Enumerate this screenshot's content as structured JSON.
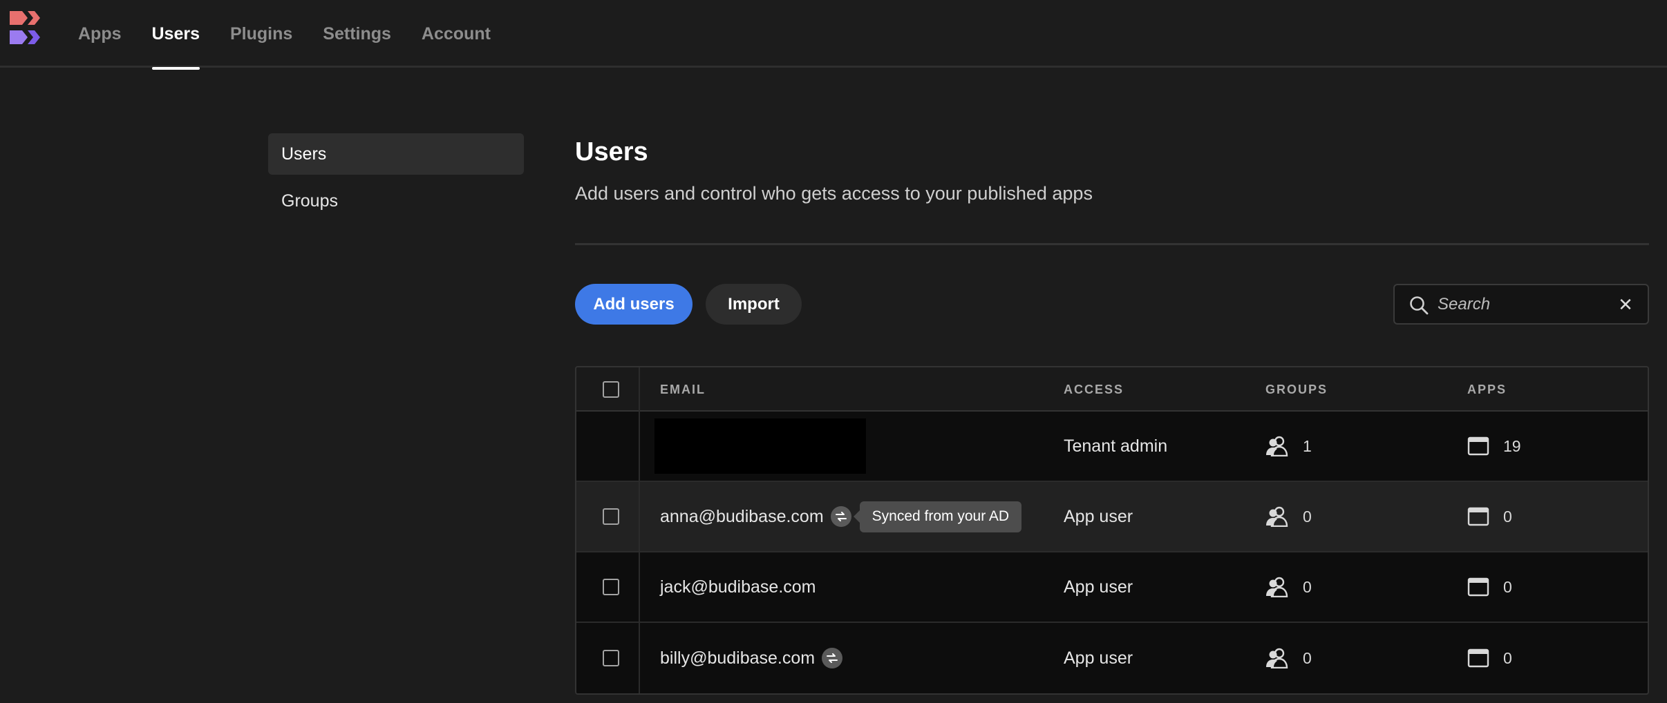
{
  "nav": {
    "items": [
      {
        "label": "Apps"
      },
      {
        "label": "Users"
      },
      {
        "label": "Plugins"
      },
      {
        "label": "Settings"
      },
      {
        "label": "Account"
      }
    ],
    "active_index": 1
  },
  "sidebar": {
    "items": [
      {
        "label": "Users"
      },
      {
        "label": "Groups"
      }
    ],
    "active_index": 0
  },
  "page": {
    "title": "Users",
    "subtitle": "Add users and control who gets access to your published apps"
  },
  "toolbar": {
    "add_label": "Add users",
    "import_label": "Import",
    "search_placeholder": "Search",
    "search_value": ""
  },
  "table": {
    "columns": [
      "EMAIL",
      "ACCESS",
      "GROUPS",
      "APPS"
    ],
    "rows": [
      {
        "email": "",
        "redacted": true,
        "synced": false,
        "access": "Tenant admin",
        "groups": "1",
        "apps": "19"
      },
      {
        "email": "anna@budibase.com",
        "synced": true,
        "tooltip": "Synced from your AD",
        "access": "App user",
        "groups": "0",
        "apps": "0"
      },
      {
        "email": "jack@budibase.com",
        "synced": false,
        "access": "App user",
        "groups": "0",
        "apps": "0"
      },
      {
        "email": "billy@budibase.com",
        "synced": true,
        "access": "App user",
        "groups": "0",
        "apps": "0"
      }
    ]
  },
  "colors": {
    "accent": "#3e79e6",
    "background": "#1c1c1c",
    "table_row": "#0d0d0d"
  }
}
